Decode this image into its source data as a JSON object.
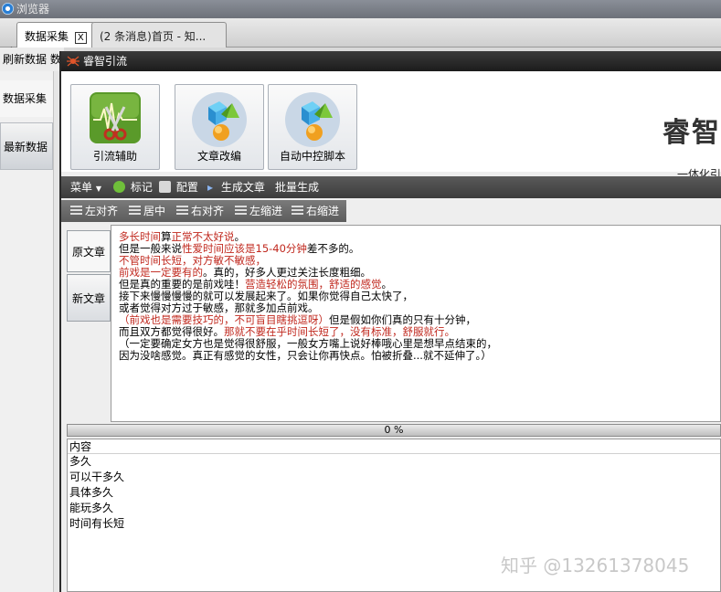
{
  "browser": {
    "title": "浏览器",
    "tabs": [
      {
        "label": "数据采集",
        "close": "X"
      },
      {
        "label": "(2 条消息)首页 - 知..."
      }
    ],
    "toolbar_text": "刷新数据  数",
    "left_nav": [
      "数据采集",
      "最新数据"
    ]
  },
  "app": {
    "title": "睿智引流",
    "big_buttons": [
      {
        "label": "引流辅助",
        "icon": "scissors-chart-icon"
      },
      {
        "label": "文章改编",
        "icon": "cubes-icon"
      },
      {
        "label": "自动中控脚本",
        "icon": "cubes-icon"
      }
    ],
    "brand": "睿智",
    "brand_sub": "一体化引",
    "menu": {
      "menu_label": "菜单",
      "menu_arrow": "▼",
      "mark": "标记",
      "config": "配置",
      "generate_arrow": "▸",
      "generate": "生成文章",
      "batch": "批量生成"
    },
    "format": {
      "align_left": "左对齐",
      "center": "居中",
      "align_right": "右对齐",
      "indent_left": "左缩进",
      "indent_right": "右缩进"
    },
    "side_tabs": [
      "原文章",
      "新文章"
    ],
    "editor_lines": [
      [
        {
          "t": "多长时间",
          "r": true
        },
        {
          "t": "算"
        },
        {
          "t": "正常不太好说",
          "r": true
        },
        {
          "t": "。"
        }
      ],
      [
        {
          "t": "但是一般来说"
        },
        {
          "t": "性爱时间应该是15-40分钟",
          "r": true
        },
        {
          "t": "差不多的。"
        }
      ],
      [
        {
          "t": "不管时间长短，对方敏不敏感，",
          "r": true
        }
      ],
      [
        {
          "t": "前戏是一定要有的",
          "r": true
        },
        {
          "t": "。真的，好多人更过关注长度粗细。"
        }
      ],
      [
        {
          "t": "但是真的重要的是前戏哇！"
        },
        {
          "t": "营造轻松的氛围，舒适的感觉",
          "r": true
        },
        {
          "t": "。"
        }
      ],
      [
        {
          "t": "接下来慢慢慢慢的就可以发展起来了。如果你觉得自己太快了，"
        }
      ],
      [
        {
          "t": "或者觉得对方过于敏感，那就多加点前戏。"
        }
      ],
      [
        {
          "t": "（前戏也是需要技巧的，不可盲目瞎挑逗呀）",
          "r": true
        },
        {
          "t": "但是假如你们真的只有十分钟，"
        }
      ],
      [
        {
          "t": "而且双方都觉得很好。"
        },
        {
          "t": "那就不要在乎时间长短了，没有标准，舒服就行。",
          "r": true
        }
      ],
      [
        {
          "t": "（一定要确定女方也是觉得很舒服，一般女方嘴上说好棒哦心里是想早点结束的，"
        }
      ],
      [
        {
          "t": "因为没啥感觉。真正有感觉的女性，只会让你再快点。怕被折叠...就不延伸了。）"
        }
      ]
    ],
    "progress": {
      "value": 0,
      "text": "0 %"
    },
    "list": {
      "header": "内容",
      "rows": [
        "多久",
        "可以干多久",
        "具体多久",
        "能玩多久",
        "时间有长短"
      ]
    },
    "accent_red": "#c0281e"
  },
  "watermark": "知乎 @13261378045"
}
